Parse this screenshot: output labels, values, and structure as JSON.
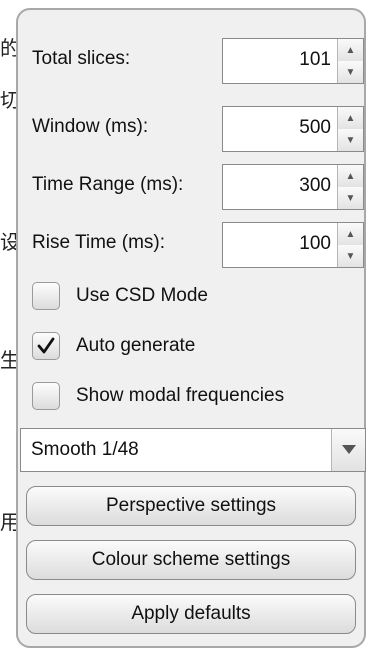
{
  "background_glyphs": [
    "的",
    "切",
    "设",
    "生",
    "用"
  ],
  "spinners": [
    {
      "label": "Total slices:",
      "value": "101"
    },
    {
      "label": "Window (ms):",
      "value": "500"
    },
    {
      "label": "Time Range (ms):",
      "value": "300"
    },
    {
      "label": "Rise Time (ms):",
      "value": "100"
    }
  ],
  "checkboxes": [
    {
      "label": "Use CSD Mode",
      "checked": false
    },
    {
      "label": "Auto generate",
      "checked": true
    },
    {
      "label": "Show modal frequencies",
      "checked": false
    }
  ],
  "smoothing": {
    "selected": "Smooth 1/48"
  },
  "buttons": {
    "perspective": "Perspective settings",
    "colour_scheme": "Colour scheme settings",
    "apply_defaults": "Apply defaults"
  },
  "icons": {
    "spinner_up": "triangle-up-icon",
    "spinner_down": "triangle-down-icon",
    "checkmark": "checkmark-icon",
    "dropdown": "chevron-down-icon"
  }
}
